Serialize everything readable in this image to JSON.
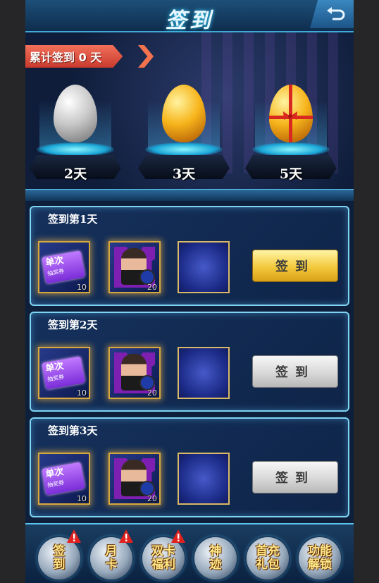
{
  "header": {
    "title": "签到",
    "back_icon": "return-arrow-icon"
  },
  "streak": {
    "text": "累计签到 0 天",
    "color": "#e8553f"
  },
  "milestones": [
    {
      "label": "2天",
      "egg": "silver-egg"
    },
    {
      "label": "3天",
      "egg": "gold-egg"
    },
    {
      "label": "5天",
      "egg": "gift-egg"
    }
  ],
  "days": [
    {
      "title": "签到第1天",
      "rewards": [
        {
          "name": "单次",
          "sub": "抽奖券",
          "count": "10"
        },
        {
          "name": "portrait-card",
          "count": "20"
        }
      ],
      "button": "签到",
      "state": "active"
    },
    {
      "title": "签到第2天",
      "rewards": [
        {
          "name": "单次",
          "sub": "抽奖券",
          "count": "10"
        },
        {
          "name": "portrait-card",
          "count": "20"
        }
      ],
      "button": "签到",
      "state": "disabled"
    },
    {
      "title": "签到第3天",
      "rewards": [
        {
          "name": "单次",
          "sub": "抽奖券",
          "count": "10"
        },
        {
          "name": "portrait-card",
          "count": "20"
        }
      ],
      "button": "签到",
      "state": "disabled"
    }
  ],
  "tabs": [
    {
      "line1": "签",
      "line2": "到",
      "badge": true
    },
    {
      "line1": "月",
      "line2": "卡",
      "badge": true
    },
    {
      "line1": "双卡",
      "line2": "福利",
      "badge": true
    },
    {
      "line1": "神",
      "line2": "迹",
      "badge": false
    },
    {
      "line1": "首充",
      "line2": "礼包",
      "badge": false
    },
    {
      "line1": "功能",
      "line2": "解锁",
      "badge": false
    }
  ],
  "colors": {
    "accent": "#7fd4f4",
    "gold_button": "#f3c83c",
    "badge": "#e0211e"
  }
}
